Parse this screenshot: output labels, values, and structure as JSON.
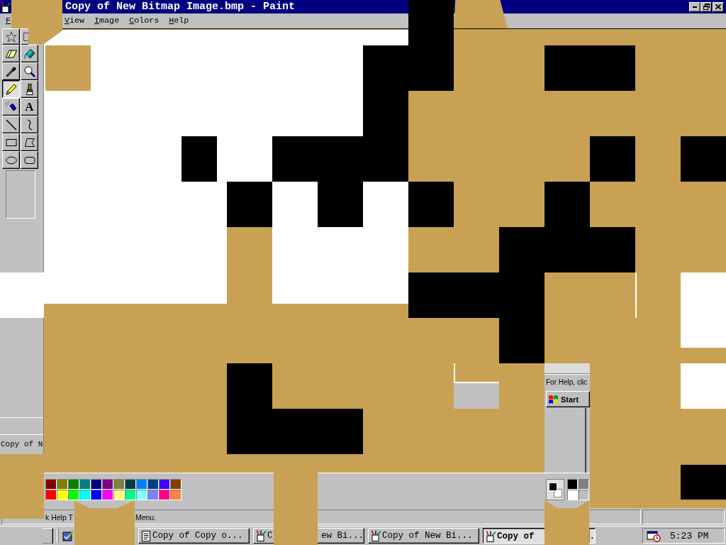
{
  "window": {
    "title": "Copy of New Bitmap Image.bmp - Paint"
  },
  "menu": [
    {
      "label": "F"
    },
    {
      "label": "View"
    },
    {
      "label": "Image"
    },
    {
      "label": "Colors"
    },
    {
      "label": "Help"
    }
  ],
  "tools": [
    {
      "kind": "free-select",
      "selected": false
    },
    {
      "kind": "select",
      "selected": false
    },
    {
      "kind": "eraser",
      "selected": false
    },
    {
      "kind": "fill",
      "selected": false
    },
    {
      "kind": "picker",
      "selected": false
    },
    {
      "kind": "magnifier",
      "selected": false
    },
    {
      "kind": "pencil",
      "selected": true
    },
    {
      "kind": "brush",
      "selected": false
    },
    {
      "kind": "airbrush",
      "selected": false
    },
    {
      "kind": "text",
      "selected": false,
      "glyph": "A"
    },
    {
      "kind": "line",
      "selected": false
    },
    {
      "kind": "curve",
      "selected": false
    },
    {
      "kind": "rectangle",
      "selected": false
    },
    {
      "kind": "polygon",
      "selected": false
    },
    {
      "kind": "ellipse",
      "selected": false
    },
    {
      "kind": "rounded-rectangle",
      "selected": false
    }
  ],
  "side_fragment": {
    "label": "Copy of N"
  },
  "palette": [
    {
      "color": "#800000"
    },
    {
      "color": "#808000"
    },
    {
      "color": "#008000"
    },
    {
      "color": "#008080"
    },
    {
      "color": "#000080"
    },
    {
      "color": "#800080"
    },
    {
      "color": "#808040"
    },
    {
      "color": "#004040"
    },
    {
      "color": "#0080ff"
    },
    {
      "color": "#004080"
    },
    {
      "color": "#4000ff"
    },
    {
      "color": "#804000"
    },
    {
      "color": "#ff0000"
    },
    {
      "color": "#ffff00"
    },
    {
      "color": "#00ff00"
    },
    {
      "color": "#00ffff"
    },
    {
      "color": "#0000ff"
    },
    {
      "color": "#ff00ff"
    },
    {
      "color": "#ffff80"
    },
    {
      "color": "#00ff80"
    },
    {
      "color": "#80ffff"
    },
    {
      "color": "#8080ff"
    },
    {
      "color": "#ff0080"
    },
    {
      "color": "#ff8040"
    }
  ],
  "status_bar": {
    "fragments": [
      "k Help T",
      "Menu."
    ]
  },
  "overlay_panel": {
    "status_text": "For Help, clic",
    "start_label": "Start",
    "swatches": [
      {
        "color": "#000000"
      },
      {
        "color": "#808080"
      },
      {
        "color": "#ffffff"
      },
      {
        "color": "#c0c0c0"
      }
    ]
  },
  "taskbar": {
    "buttons": [
      {
        "kind": "notepad",
        "selected": false,
        "fragments": [
          "Copy of Copy o..."
        ]
      },
      {
        "kind": "paint",
        "selected": false,
        "fragments": [
          "C",
          "ew Bi..."
        ]
      },
      {
        "kind": "paint",
        "selected": false,
        "fragments": [
          "Copy of New Bi..."
        ]
      },
      {
        "kind": "paint",
        "selected": true,
        "fragments": [
          "Copy of",
          "."
        ]
      }
    ],
    "clock": "5:23 PM"
  }
}
